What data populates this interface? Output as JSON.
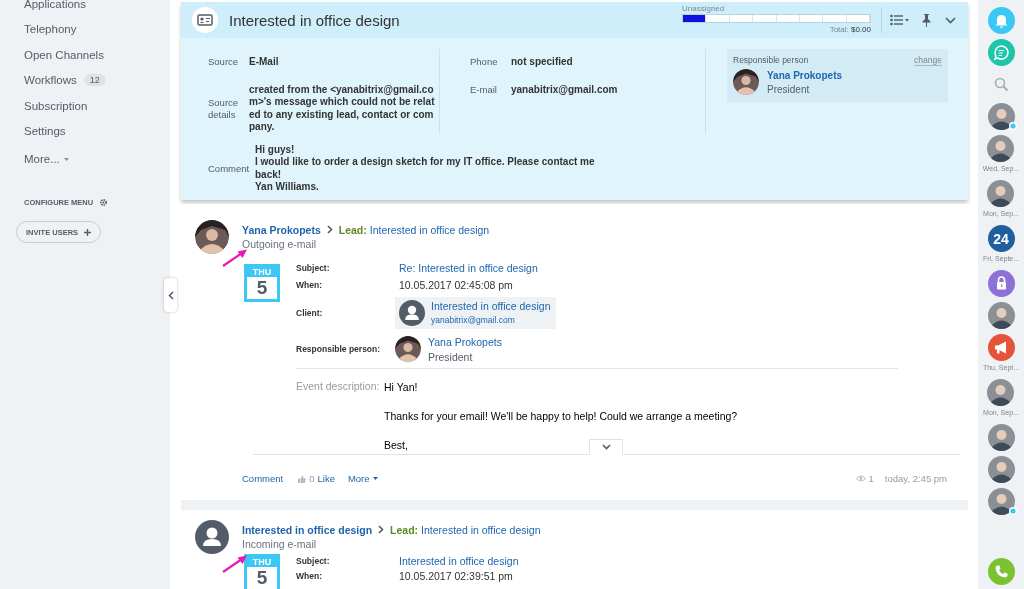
{
  "sidebar": {
    "items": [
      {
        "label": "Applications"
      },
      {
        "label": "Telephony"
      },
      {
        "label": "Open Channels"
      },
      {
        "label": "Workflows",
        "counter": "12"
      },
      {
        "label": "Subscription"
      },
      {
        "label": "Settings"
      }
    ],
    "more": "More...",
    "configure": "CONFIGURE MENU",
    "invite": "INVITE USERS"
  },
  "lead_card": {
    "title": "Interested in office design",
    "stage": {
      "label": "Unassigned",
      "level": 0.12
    },
    "total": {
      "label": "Total:",
      "value": "$0.00"
    },
    "source_fields": [
      {
        "label": "Source",
        "value": "E-Mail"
      },
      {
        "label": "Source details",
        "value": "created from the <yanabitrix@gmail.com>'s message which could not be related to any existing lead, contact or company."
      }
    ],
    "contact_fields": [
      {
        "label": "Phone",
        "value": "not specified"
      },
      {
        "label": "E-mail",
        "value": "yanabitrix@gmail.com"
      }
    ],
    "responsible": {
      "heading": "Responsible person",
      "action": "change",
      "name": "Yana Prokopets",
      "position": "President"
    },
    "comment": {
      "label": "Comment",
      "lines": [
        "Hi guys!",
        "I would like to order a design sketch for my IT office. Please contact me back!",
        "Yan Williams."
      ]
    }
  },
  "timeline": [
    {
      "avatar": {
        "kind": "photo"
      },
      "author": "Yana Prokopets",
      "entity_label": "Lead:",
      "entity": "Interested in office design",
      "subtitle": "Outgoing e-mail",
      "day": "THU",
      "date": "5",
      "fields": [
        {
          "label": "Subject:",
          "kind": "link",
          "value": "Re: Interested in office design"
        },
        {
          "label": "When:",
          "kind": "text",
          "value": "10.05.2017 02:45:08 pm"
        },
        {
          "label": "Client:",
          "kind": "client",
          "name": "Interested in office design",
          "email": "yanabitrix@gmail.com"
        },
        {
          "label": "Responsible person:",
          "kind": "person",
          "name": "Yana Prokopets",
          "position": "President"
        }
      ],
      "description": {
        "label": "Event description:",
        "lines": [
          "Hi Yan!",
          "Thanks for your email! We'll be happy to help! Could we arrange a meeting?",
          "Best,"
        ]
      },
      "footer": {
        "comment": "Comment",
        "likes": "0",
        "like": "Like",
        "more": "More",
        "views": "1",
        "time": "today, 2:45 pm"
      }
    },
    {
      "avatar": {
        "kind": "placeholder"
      },
      "author": "Interested in office design",
      "entity_label": "Lead:",
      "entity": "Interested in office design",
      "subtitle": "Incoming e-mail",
      "day": "THU",
      "date": "5",
      "fields": [
        {
          "label": "Subject:",
          "kind": "link",
          "value": "Interested in office design"
        },
        {
          "label": "When:",
          "kind": "text",
          "value": "10.05.2017 02:39:51 pm"
        }
      ]
    }
  ],
  "right_bar": [
    {
      "kind": "bell",
      "online": false
    },
    {
      "kind": "chat",
      "online": false
    },
    {
      "kind": "search",
      "online": false
    },
    {
      "kind": "avatar",
      "online": true
    },
    {
      "kind": "avatar",
      "online": false,
      "caption": "Wed, Sep..."
    },
    {
      "kind": "avatar",
      "online": false,
      "caption": "Mon, Sep..."
    },
    {
      "kind": "number",
      "text": "24",
      "online": false,
      "caption": "Fri, Septe..."
    },
    {
      "kind": "lock",
      "online": false
    },
    {
      "kind": "avatar",
      "online": false
    },
    {
      "kind": "megaphone",
      "online": false,
      "caption": "Thu, Sept..."
    },
    {
      "kind": "avatar",
      "online": false,
      "caption": "Mon, Sep..."
    },
    {
      "kind": "avatar",
      "online": false
    },
    {
      "kind": "avatar",
      "online": false
    },
    {
      "kind": "avatar",
      "online": true
    },
    {
      "kind": "phone",
      "online": false
    }
  ]
}
